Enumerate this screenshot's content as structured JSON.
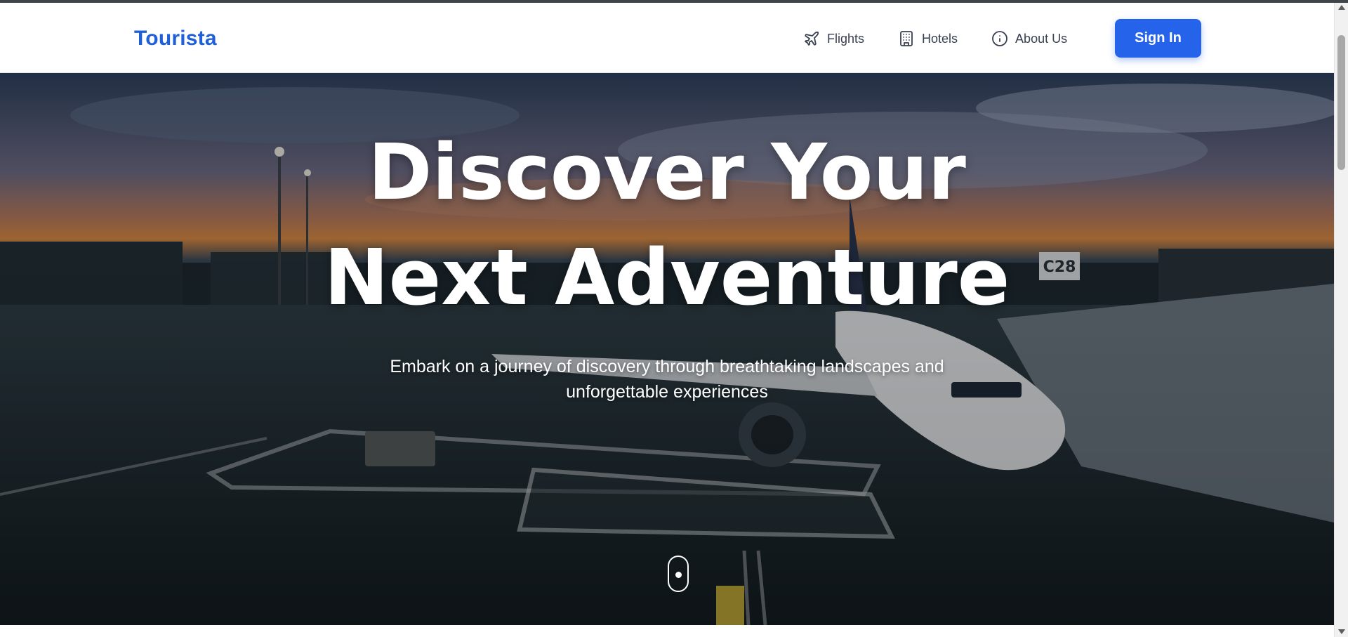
{
  "brand": {
    "name": "Tourista",
    "color": "#1f5fd8"
  },
  "nav": {
    "items": [
      {
        "label": "Flights",
        "icon": "plane-icon"
      },
      {
        "label": "Hotels",
        "icon": "building-icon"
      },
      {
        "label": "About Us",
        "icon": "info-icon"
      }
    ],
    "signin_label": "Sign In"
  },
  "hero": {
    "title_line1": "Discover Your",
    "title_line2": "Next Adventure",
    "subtitle": "Embark on a journey of discovery through breathtaking landscapes and unforgettable experiences",
    "background": "airport-sunset-airplane-photo"
  },
  "colors": {
    "accent": "#2563eb",
    "nav_text": "#374151",
    "hero_text": "#ffffff"
  }
}
